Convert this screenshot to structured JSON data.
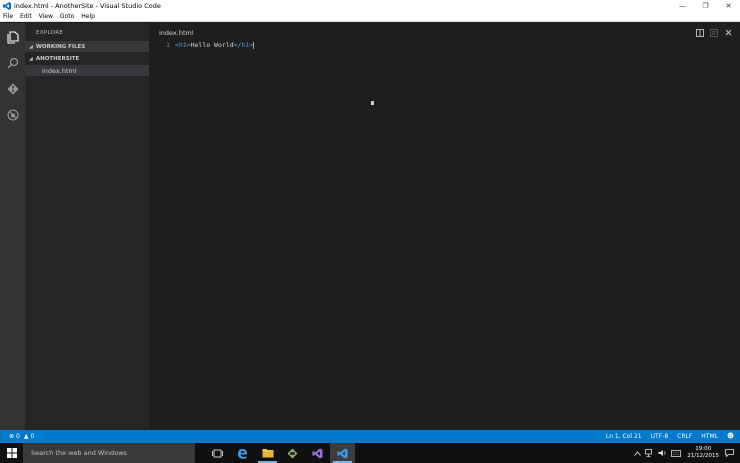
{
  "window": {
    "title": "index.html - AnotherSite - Visual Studio Code",
    "minimize_glyph": "—",
    "restore_glyph": "❐",
    "close_glyph": "✕"
  },
  "menu": [
    "File",
    "Edit",
    "View",
    "Goto",
    "Help"
  ],
  "activity": [
    "explorer-icon",
    "search-icon",
    "git-icon",
    "debug-icon"
  ],
  "sidebar": {
    "title": "EXPLORE",
    "sections": [
      {
        "label": "WORKING FILES"
      },
      {
        "label": "ANOTHERSITE"
      }
    ],
    "files": [
      "index.html"
    ]
  },
  "editor": {
    "tab_title": "index.html",
    "line_number": "1",
    "code": {
      "open_tag": "<h1>",
      "text": "Hello World",
      "close_tag": "</h1>"
    }
  },
  "status": {
    "errors": "0",
    "warnings": "0",
    "position": "Ln 1, Col 21",
    "encoding": "UTF-8",
    "eol": "CRLF",
    "language": "HTML"
  },
  "taskbar": {
    "search_placeholder": "Search the web and Windows",
    "apps": [
      "task-view-icon",
      "edge-icon",
      "file-explorer-icon",
      "git-bash-icon",
      "visual-studio-icon",
      "vscode-icon"
    ],
    "time": "19:00",
    "date": "21/12/2015"
  },
  "colors": {
    "accent": "#007acc",
    "activitybar": "#333333",
    "sidebar": "#252526",
    "editor": "#1e1e1e",
    "tag": "#569cd6"
  }
}
